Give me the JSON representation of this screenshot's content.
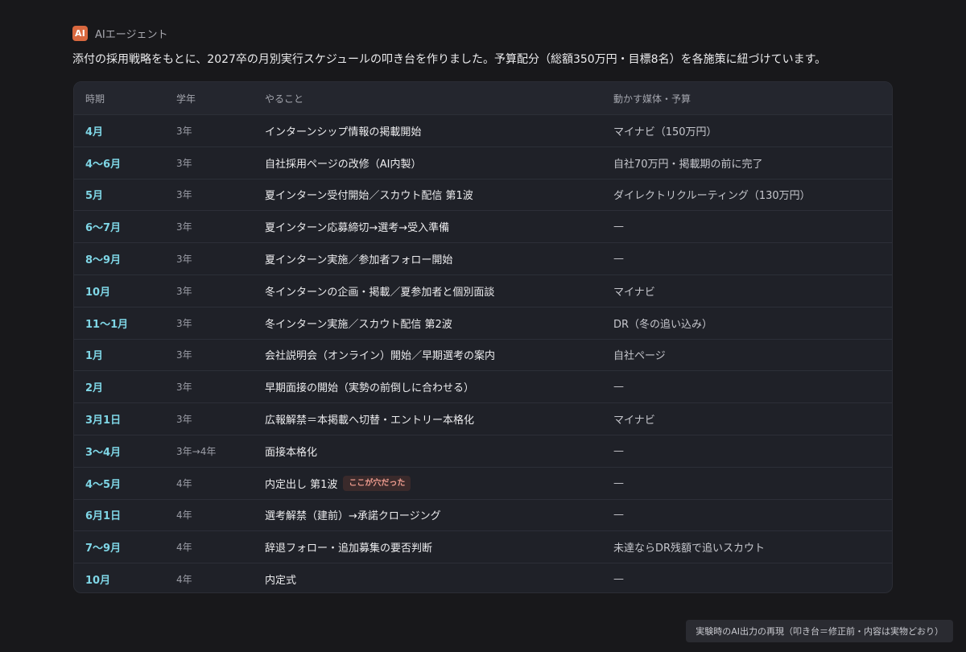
{
  "agent": {
    "badge": "AI",
    "name": "AIエージェント"
  },
  "intro": "添付の採用戦略をもとに、2027卒の月別実行スケジュールの叩き台を作りました。予算配分（総額350万円・目標8名）を各施策に紐づけています。",
  "table": {
    "headers": [
      "時期",
      "学年",
      "やること",
      "動かす媒体・予算"
    ],
    "rows": [
      {
        "time": "4月",
        "grade": "3年",
        "todo": "インターンシップ情報の掲載開始",
        "tag": "",
        "media": "マイナビ（150万円）"
      },
      {
        "time": "4〜6月",
        "grade": "3年",
        "todo": "自社採用ページの改修（AI内製）",
        "tag": "",
        "media": "自社70万円・掲載期の前に完了"
      },
      {
        "time": "5月",
        "grade": "3年",
        "todo": "夏インターン受付開始／スカウト配信 第1波",
        "tag": "",
        "media": "ダイレクトリクルーティング（130万円）"
      },
      {
        "time": "6〜7月",
        "grade": "3年",
        "todo": "夏インターン応募締切→選考→受入準備",
        "tag": "",
        "media": "—"
      },
      {
        "time": "8〜9月",
        "grade": "3年",
        "todo": "夏インターン実施／参加者フォロー開始",
        "tag": "",
        "media": "—"
      },
      {
        "time": "10月",
        "grade": "3年",
        "todo": "冬インターンの企画・掲載／夏参加者と個別面談",
        "tag": "",
        "media": "マイナビ"
      },
      {
        "time": "11〜1月",
        "grade": "3年",
        "todo": "冬インターン実施／スカウト配信 第2波",
        "tag": "",
        "media": "DR（冬の追い込み）"
      },
      {
        "time": "1月",
        "grade": "3年",
        "todo": "会社説明会（オンライン）開始／早期選考の案内",
        "tag": "",
        "media": "自社ページ"
      },
      {
        "time": "2月",
        "grade": "3年",
        "todo": "早期面接の開始（実勢の前倒しに合わせる）",
        "tag": "",
        "media": "—"
      },
      {
        "time": "3月1日",
        "grade": "3年",
        "todo": "広報解禁＝本掲載へ切替・エントリー本格化",
        "tag": "",
        "media": "マイナビ"
      },
      {
        "time": "3〜4月",
        "grade": "3年→4年",
        "todo": "面接本格化",
        "tag": "",
        "media": "—"
      },
      {
        "time": "4〜5月",
        "grade": "4年",
        "todo": "内定出し 第1波",
        "tag": "ここが穴だった",
        "media": "—"
      },
      {
        "time": "6月1日",
        "grade": "4年",
        "todo": "選考解禁（建前）→承諾クロージング",
        "tag": "",
        "media": "—"
      },
      {
        "time": "7〜9月",
        "grade": "4年",
        "todo": "辞退フォロー・追加募集の要否判断",
        "tag": "",
        "media": "未達ならDR残額で追いスカウト"
      },
      {
        "time": "10月",
        "grade": "4年",
        "todo": "内定式",
        "tag": "",
        "media": "—"
      }
    ]
  },
  "footnote": "実験時のAI出力の再現（叩き台＝修正前・内容は実物どおり）",
  "colors": {
    "background": "#18181b",
    "table_bg": "#1f2128",
    "accent_time": "#7fd6e6",
    "badge": "#d9683f",
    "tag_text": "#ee9b8e",
    "tag_bg": "#3a2a2b"
  }
}
